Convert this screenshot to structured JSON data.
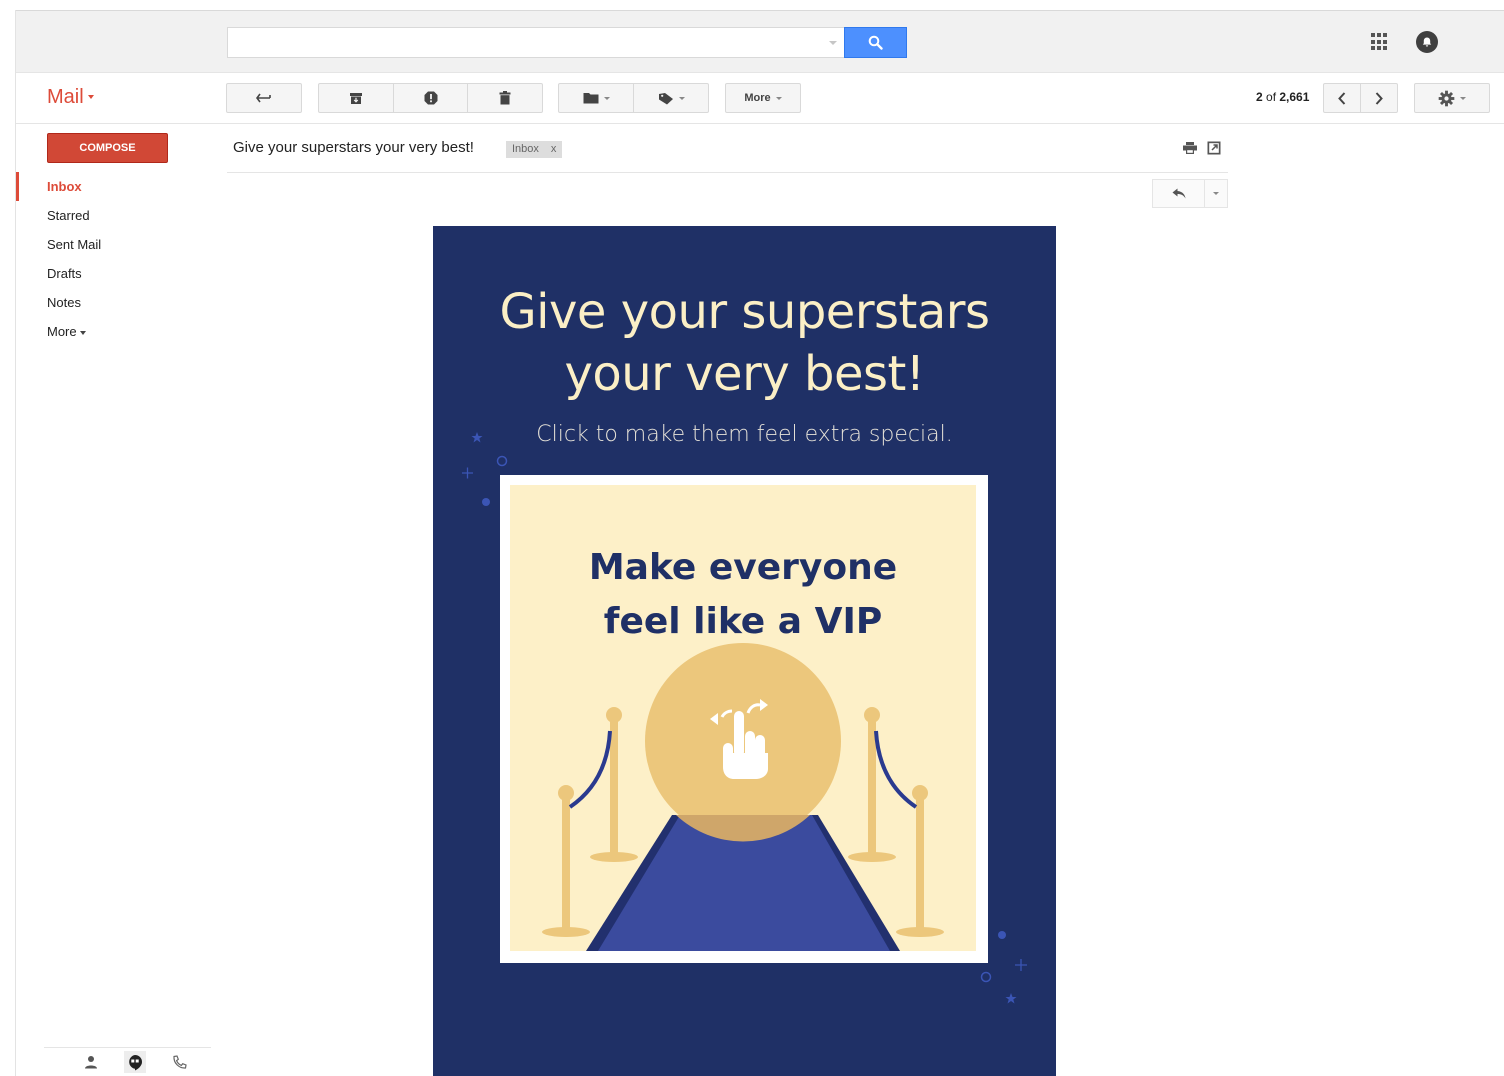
{
  "header": {
    "search_placeholder": "",
    "search_value": ""
  },
  "toolbar": {
    "app_label": "Mail",
    "more_label": "More",
    "pager_current": "2",
    "pager_of": " of ",
    "pager_total": "2,661"
  },
  "sidebar": {
    "compose_label": "COMPOSE",
    "items": [
      {
        "label": "Inbox",
        "active": true
      },
      {
        "label": "Starred"
      },
      {
        "label": "Sent Mail"
      },
      {
        "label": "Drafts"
      },
      {
        "label": "Notes"
      },
      {
        "label": "More"
      }
    ]
  },
  "message": {
    "subject": "Give your superstars your very best!",
    "label_chip": "Inbox",
    "label_remove": "x"
  },
  "email_body": {
    "headline_line1": "Give your superstars",
    "headline_line2": "your very best!",
    "subhead": "Click to make them feel extra special.",
    "card_line1": "Make everyone",
    "card_line2": "feel like a VIP"
  },
  "colors": {
    "accent_red": "#dd4b39",
    "compose_red": "#d14836",
    "search_blue": "#4d90fe",
    "email_navy": "#1f3066",
    "email_cream": "#fdf0c8",
    "gold": "#ebc77b",
    "carpet_blue": "#3b4b9e"
  },
  "icons": {
    "search": "search-icon",
    "apps": "apps-grid-icon",
    "notifications": "notifications-icon",
    "reply": "reply-icon",
    "archive": "archive-icon",
    "spam": "report-spam-icon",
    "delete": "trash-icon",
    "move": "folder-icon",
    "labels": "label-tag-icon",
    "prev": "chevron-left-icon",
    "next": "chevron-right-icon",
    "settings": "gear-icon",
    "print": "print-icon",
    "new_window": "new-window-icon",
    "contacts": "person-icon",
    "hangouts": "hangouts-icon",
    "phone": "phone-icon"
  }
}
